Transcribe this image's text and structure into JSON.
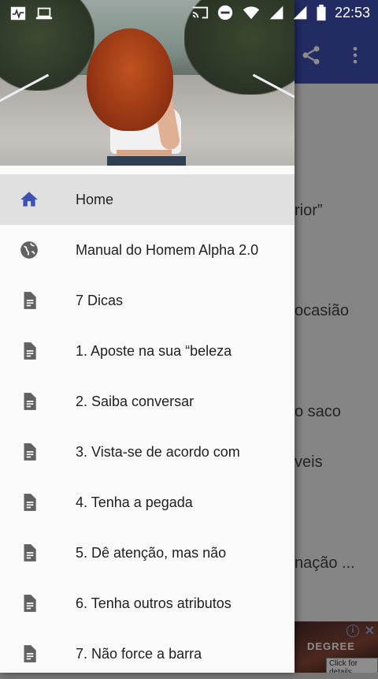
{
  "status_bar": {
    "time": "22:53",
    "icons_left": [
      "activity-icon",
      "laptop-icon"
    ],
    "icons_right": [
      "cast-icon",
      "do-not-disturb-icon",
      "wifi-icon",
      "signal-icon",
      "signal-icon",
      "battery-icon"
    ]
  },
  "background": {
    "toolbar_color": "#3f51b5",
    "toolbar_icons": [
      "share-icon",
      "more-vert-icon"
    ],
    "visible_text": [
      "rior”",
      "ocasião",
      "o saco",
      "veis",
      "nação ..."
    ],
    "ad": {
      "brand": "DEGREE",
      "click": "Click for details"
    }
  },
  "drawer": {
    "menu": [
      {
        "icon": "home-icon",
        "label": "Home",
        "active": true
      },
      {
        "icon": "globe-icon",
        "label": "Manual do Homem Alpha 2.0",
        "active": false
      },
      {
        "icon": "document-icon",
        "label": "7 Dicas",
        "active": false
      },
      {
        "icon": "document-icon",
        "label": "1. Aposte na sua “beleza",
        "active": false
      },
      {
        "icon": "document-icon",
        "label": "2. Saiba conversar",
        "active": false
      },
      {
        "icon": "document-icon",
        "label": "3. Vista-se de acordo com",
        "active": false
      },
      {
        "icon": "document-icon",
        "label": "4. Tenha a pegada",
        "active": false
      },
      {
        "icon": "document-icon",
        "label": "5. Dê atenção, mas não",
        "active": false
      },
      {
        "icon": "document-icon",
        "label": "6. Tenha outros atributos",
        "active": false
      },
      {
        "icon": "document-icon",
        "label": "7. Não force a barra",
        "active": false
      }
    ],
    "active_icon_color": "#3f51b5",
    "icon_color": "#616161"
  }
}
